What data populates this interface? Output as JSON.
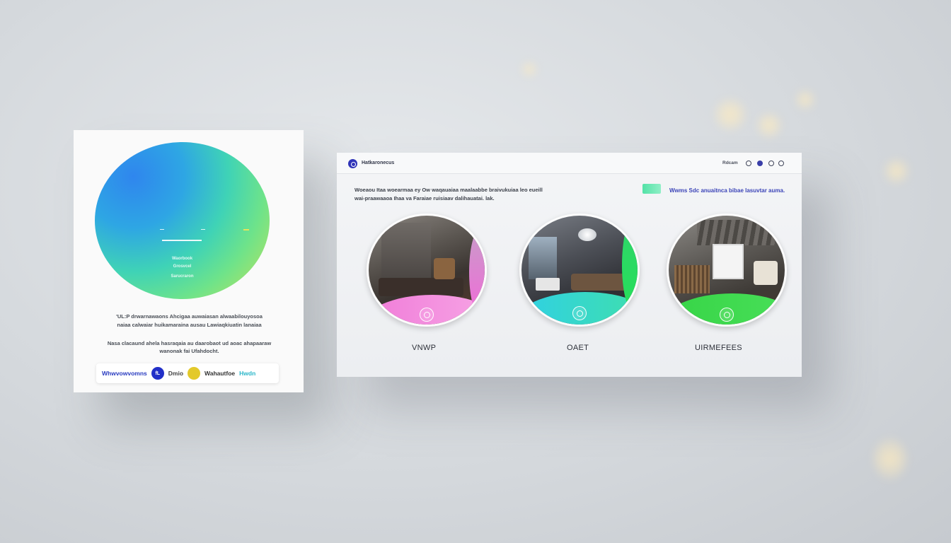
{
  "left_card": {
    "orb_label_1": "Waorbook",
    "orb_label_2": "Grosvcel",
    "orb_label_3": "Sarucraron",
    "text_1": "'UL:P drwarnawaons Ahcigaa auwaiasan alwaabilouyosoa",
    "text_2": "naiaa calwaiar huikamaraina ausau Lawiaqkiuatin lanaiaa",
    "text_3": "Nasa clacaund ahela hasraqaia au daarobaot ud aoac ahapaaraw",
    "text_4": "wanonak fai Ufahdocht.",
    "brand_1": "Whwvowvomns",
    "brand_2_icon": "fL",
    "brand_2": "Dmio",
    "brand_3": "Wahautfoe",
    "brand_4": "Hwdn"
  },
  "right_window": {
    "title": "Hatkaronecus",
    "nav_label": "Rdcam",
    "description_1": "Woeaou Itaa woearmaa ey Ow waqauaiaa maalaabbe braivukuiaa leo eueill",
    "description_2": "wai-praawaaoa Ihaa va Faraiae ruisiaav dalihauatai. lak.",
    "cta": "Wwms Sdc  anuaitnca bibae lasuvtar auma.",
    "rooms": [
      {
        "label": "VNWP",
        "image": "bedroom-photo"
      },
      {
        "label": "OAET",
        "image": "living-room-photo"
      },
      {
        "label": "UIRMEFEES",
        "image": "attic-room-photo"
      }
    ]
  },
  "colors": {
    "accent_blue": "#3034b8",
    "accent_green": "#53e2a7",
    "pink": "#f06cd8",
    "cyan": "#2fd0e6",
    "green": "#3ad84a"
  }
}
